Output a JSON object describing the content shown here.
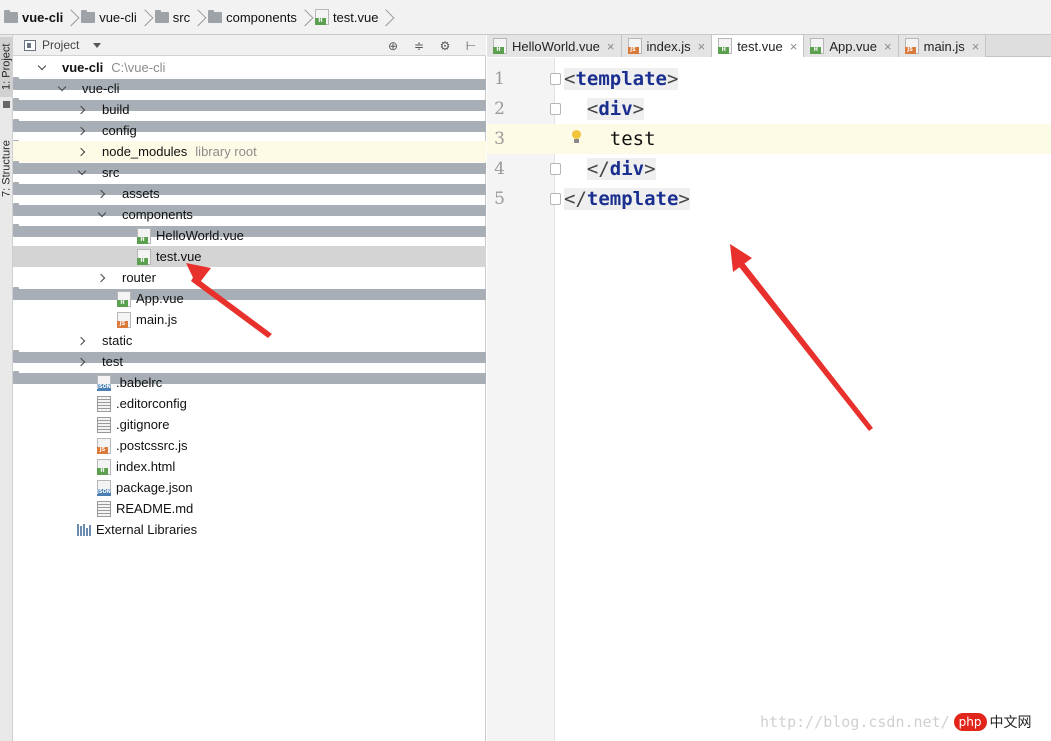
{
  "breadcrumb": [
    {
      "label": "vue-cli",
      "icon": "folder-icon",
      "bold": true
    },
    {
      "label": "vue-cli",
      "icon": "folder-icon"
    },
    {
      "label": "src",
      "icon": "folder-icon"
    },
    {
      "label": "components",
      "icon": "folder-icon"
    },
    {
      "label": "test.vue",
      "icon": "vue-file-icon"
    }
  ],
  "tool_strip": {
    "project_tab": "1: Project",
    "structure_tab": "7: Structure"
  },
  "project_panel": {
    "title": "Project",
    "tools": [
      "⊕",
      "≑",
      "⚙",
      "⊢"
    ],
    "tree": [
      {
        "name": "vue-cli",
        "hint": "C:\\vue-cli",
        "type": "folder",
        "expanded": true,
        "level": 0,
        "bold": true
      },
      {
        "name": "vue-cli",
        "type": "folder",
        "expanded": true,
        "level": 1
      },
      {
        "name": "build",
        "type": "folder",
        "expanded": false,
        "level": 2
      },
      {
        "name": "config",
        "type": "folder",
        "expanded": false,
        "level": 2
      },
      {
        "name": "node_modules",
        "hint": "library root",
        "type": "folder",
        "expanded": false,
        "level": 2,
        "library": true
      },
      {
        "name": "src",
        "type": "folder",
        "expanded": true,
        "level": 2
      },
      {
        "name": "assets",
        "type": "folder",
        "expanded": false,
        "level": 3
      },
      {
        "name": "components",
        "type": "folder",
        "expanded": true,
        "level": 3
      },
      {
        "name": "HelloWorld.vue",
        "type": "vue",
        "level": 4
      },
      {
        "name": "test.vue",
        "type": "vue",
        "level": 4,
        "selected": true
      },
      {
        "name": "router",
        "type": "folder",
        "expanded": false,
        "level": 3
      },
      {
        "name": "App.vue",
        "type": "vue",
        "level": 3
      },
      {
        "name": "main.js",
        "type": "js",
        "level": 3
      },
      {
        "name": "static",
        "type": "folder",
        "expanded": false,
        "level": 2
      },
      {
        "name": "test",
        "type": "folder",
        "expanded": false,
        "level": 2
      },
      {
        "name": ".babelrc",
        "type": "json",
        "level": 2
      },
      {
        "name": ".editorconfig",
        "type": "txt",
        "level": 2
      },
      {
        "name": ".gitignore",
        "type": "txt",
        "level": 2
      },
      {
        "name": ".postcssrc.js",
        "type": "js",
        "level": 2
      },
      {
        "name": "index.html",
        "type": "html",
        "level": 2
      },
      {
        "name": "package.json",
        "type": "json",
        "level": 2
      },
      {
        "name": "README.md",
        "type": "txt",
        "level": 2
      },
      {
        "name": "External Libraries",
        "type": "libraries",
        "level": 1
      }
    ]
  },
  "editor": {
    "tabs": [
      {
        "label": "HelloWorld.vue",
        "type": "vue"
      },
      {
        "label": "index.js",
        "type": "js"
      },
      {
        "label": "test.vue",
        "type": "vue",
        "active": true
      },
      {
        "label": "App.vue",
        "type": "vue"
      },
      {
        "label": "main.js",
        "type": "js"
      }
    ],
    "close_glyph": "×",
    "lines": [
      {
        "no": "1",
        "indent": "",
        "kind": "open",
        "tag": "template",
        "bracketHighlight": true
      },
      {
        "no": "2",
        "indent": "  ",
        "kind": "open",
        "tag": "div",
        "bracketHighlight": true
      },
      {
        "no": "3",
        "indent": "    ",
        "kind": "text",
        "text": "test",
        "current": true
      },
      {
        "no": "4",
        "indent": "  ",
        "kind": "close",
        "tag": "div",
        "bracketHighlight": true
      },
      {
        "no": "5",
        "indent": "",
        "kind": "close",
        "tag": "template",
        "bracketHighlight": true
      }
    ]
  },
  "file_tag_labels": {
    "vue": "H",
    "js": "JS",
    "json": "JSON",
    "html": "H"
  },
  "watermark": {
    "url": "http://blog.csdn.net/",
    "badge": "php",
    "site": "中文网"
  },
  "colors": {
    "arrow": "#e8312c",
    "selected_row": "#d4d4d4",
    "library_row": "#fdfbe5",
    "current_line": "#fdfbe6",
    "tag_name": "#1a2f8f"
  }
}
